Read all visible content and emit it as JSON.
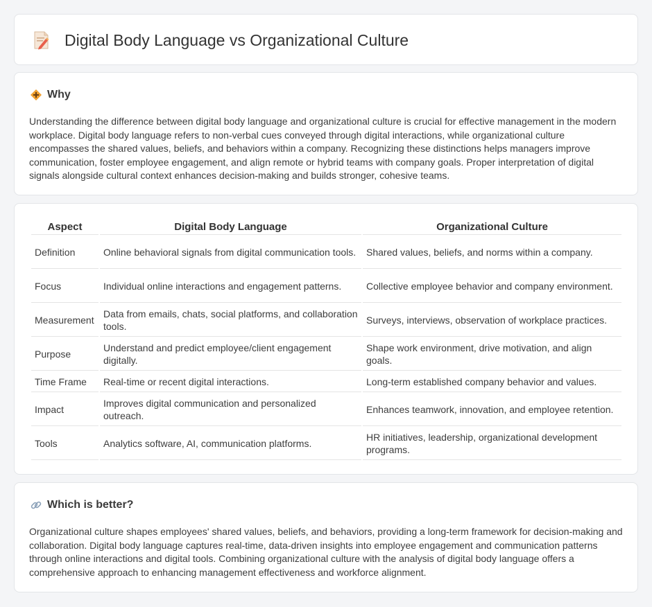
{
  "header": {
    "title": "Digital Body Language vs Organizational Culture",
    "icon": "document-pencil-icon"
  },
  "why": {
    "icon": "diamond-signal-icon",
    "heading": "Why",
    "body": "Understanding the difference between digital body language and organizational culture is crucial for effective management in the modern workplace. Digital body language refers to non-verbal cues conveyed through digital interactions, while organizational culture encompasses the shared values, beliefs, and behaviors within a company. Recognizing these distinctions helps managers improve communication, foster employee engagement, and align remote or hybrid teams with company goals. Proper interpretation of digital signals alongside cultural context enhances decision-making and builds stronger, cohesive teams."
  },
  "table": {
    "headers": [
      "Aspect",
      "Digital Body Language",
      "Organizational Culture"
    ],
    "rows": [
      [
        "Definition",
        "Online behavioral signals from digital communication tools.",
        "Shared values, beliefs, and norms within a company."
      ],
      [
        "Focus",
        "Individual online interactions and engagement patterns.",
        "Collective employee behavior and company environment."
      ],
      [
        "Measurement",
        "Data from emails, chats, social platforms, and collaboration tools.",
        "Surveys, interviews, observation of workplace practices."
      ],
      [
        "Purpose",
        "Understand and predict employee/client engagement digitally.",
        "Shape work environment, drive motivation, and align goals."
      ],
      [
        "Time Frame",
        "Real-time or recent digital interactions.",
        "Long-term established company behavior and values."
      ],
      [
        "Impact",
        "Improves digital communication and personalized outreach.",
        "Enhances teamwork, innovation, and employee retention."
      ],
      [
        "Tools",
        "Analytics software, AI, communication platforms.",
        "HR initiatives, leadership, organizational development programs."
      ]
    ]
  },
  "better": {
    "icon": "link-icon",
    "heading": "Which is better?",
    "body": "Organizational culture shapes employees' shared values, beliefs, and behaviors, providing a long-term framework for decision-making and collaboration. Digital body language captures real-time, data-driven insights into employee engagement and communication patterns through online interactions and digital tools. Combining organizational culture with the analysis of digital body language offers a comprehensive approach to enhancing management effectiveness and workforce alignment."
  },
  "colors": {
    "page_bg": "#f4f5f7",
    "card_bg": "#ffffff",
    "border": "#e3e5e8",
    "icon_orange": "#f0a030",
    "icon_pink": "#e26a6a"
  }
}
